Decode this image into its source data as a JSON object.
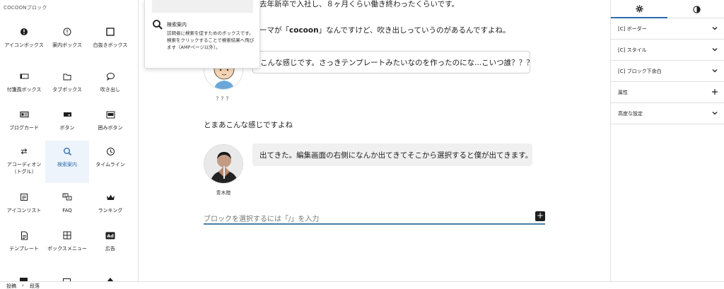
{
  "inserter": {
    "category": "COCOONブロック",
    "blocks": [
      {
        "label": "アイコンボックス",
        "icon": "info-filled-icon"
      },
      {
        "label": "案内ボックス",
        "icon": "info-outline-icon"
      },
      {
        "label": "白抜きボックス",
        "icon": "square-icon"
      },
      {
        "label": "付箋風ボックス",
        "icon": "sticky-note-icon"
      },
      {
        "label": "タブボックス",
        "icon": "folder-icon"
      },
      {
        "label": "吹き出し",
        "icon": "speech-bubble-icon"
      },
      {
        "label": "ブログカード",
        "icon": "card-icon"
      },
      {
        "label": "ボタン",
        "icon": "button-icon"
      },
      {
        "label": "囲みボタン",
        "icon": "framed-button-icon"
      },
      {
        "label": "アコーディオン（トグル）",
        "icon": "toggle-arrows-icon"
      },
      {
        "label": "検索案内",
        "icon": "search-icon"
      },
      {
        "label": "タイムライン",
        "icon": "clock-icon"
      },
      {
        "label": "アイコンリスト",
        "icon": "list-icon"
      },
      {
        "label": "FAQ",
        "icon": "faq-icon"
      },
      {
        "label": "ランキング",
        "icon": "crown-icon"
      },
      {
        "label": "テンプレート",
        "icon": "document-icon"
      },
      {
        "label": "ボックスメニュー",
        "icon": "grid-icon"
      },
      {
        "label": "広告",
        "icon": "ad-icon"
      }
    ]
  },
  "tooltip": {
    "title": "検索案内",
    "description": "訪問者に検索を促すためのボックスです。検索をクリックすることで検索結果へ飛びます（AMPページ以外）。"
  },
  "editor": {
    "para1": "去年新卒で入社し、８ヶ月くらい働き終わったくらいです。",
    "para2_pre": "ーマが「",
    "para2_bold": "cocoon",
    "para2_post": "」なんですけど、吹き出しっていうのがあるんですよね。",
    "bubble1_text": "こんな感じです。さっきテンプレートみたいなのを作ったのにな...こいつ誰？？？",
    "bubble1_name": "？？？",
    "para3": "とまあこんな感じですよね",
    "bubble2_text": "出てきた。編集画面の右側になんか出てきてそこから選択すると僕が出てきます。",
    "bubble2_name": "青木陸",
    "appender_placeholder": "ブロックを選択するには「/」を入力"
  },
  "sidebar": {
    "tabs": [
      {
        "icon": "gear-icon"
      },
      {
        "icon": "contrast-icon"
      }
    ],
    "panels": [
      {
        "title": "[C] ボーダー",
        "control": "chevron-down-icon"
      },
      {
        "title": "[C] スタイル",
        "control": "chevron-down-icon"
      },
      {
        "title": "[C] ブロック下余白",
        "control": "chevron-down-icon"
      },
      {
        "title": "属性",
        "control": "plus-icon"
      },
      {
        "title": "高度な設定",
        "control": "chevron-down-icon"
      }
    ]
  },
  "footer": {
    "crumb1": "投稿",
    "separator": "›",
    "crumb2": "段落"
  },
  "colors": {
    "accent": "#2b6cb0",
    "appender_underline": "#4a7fa8"
  }
}
